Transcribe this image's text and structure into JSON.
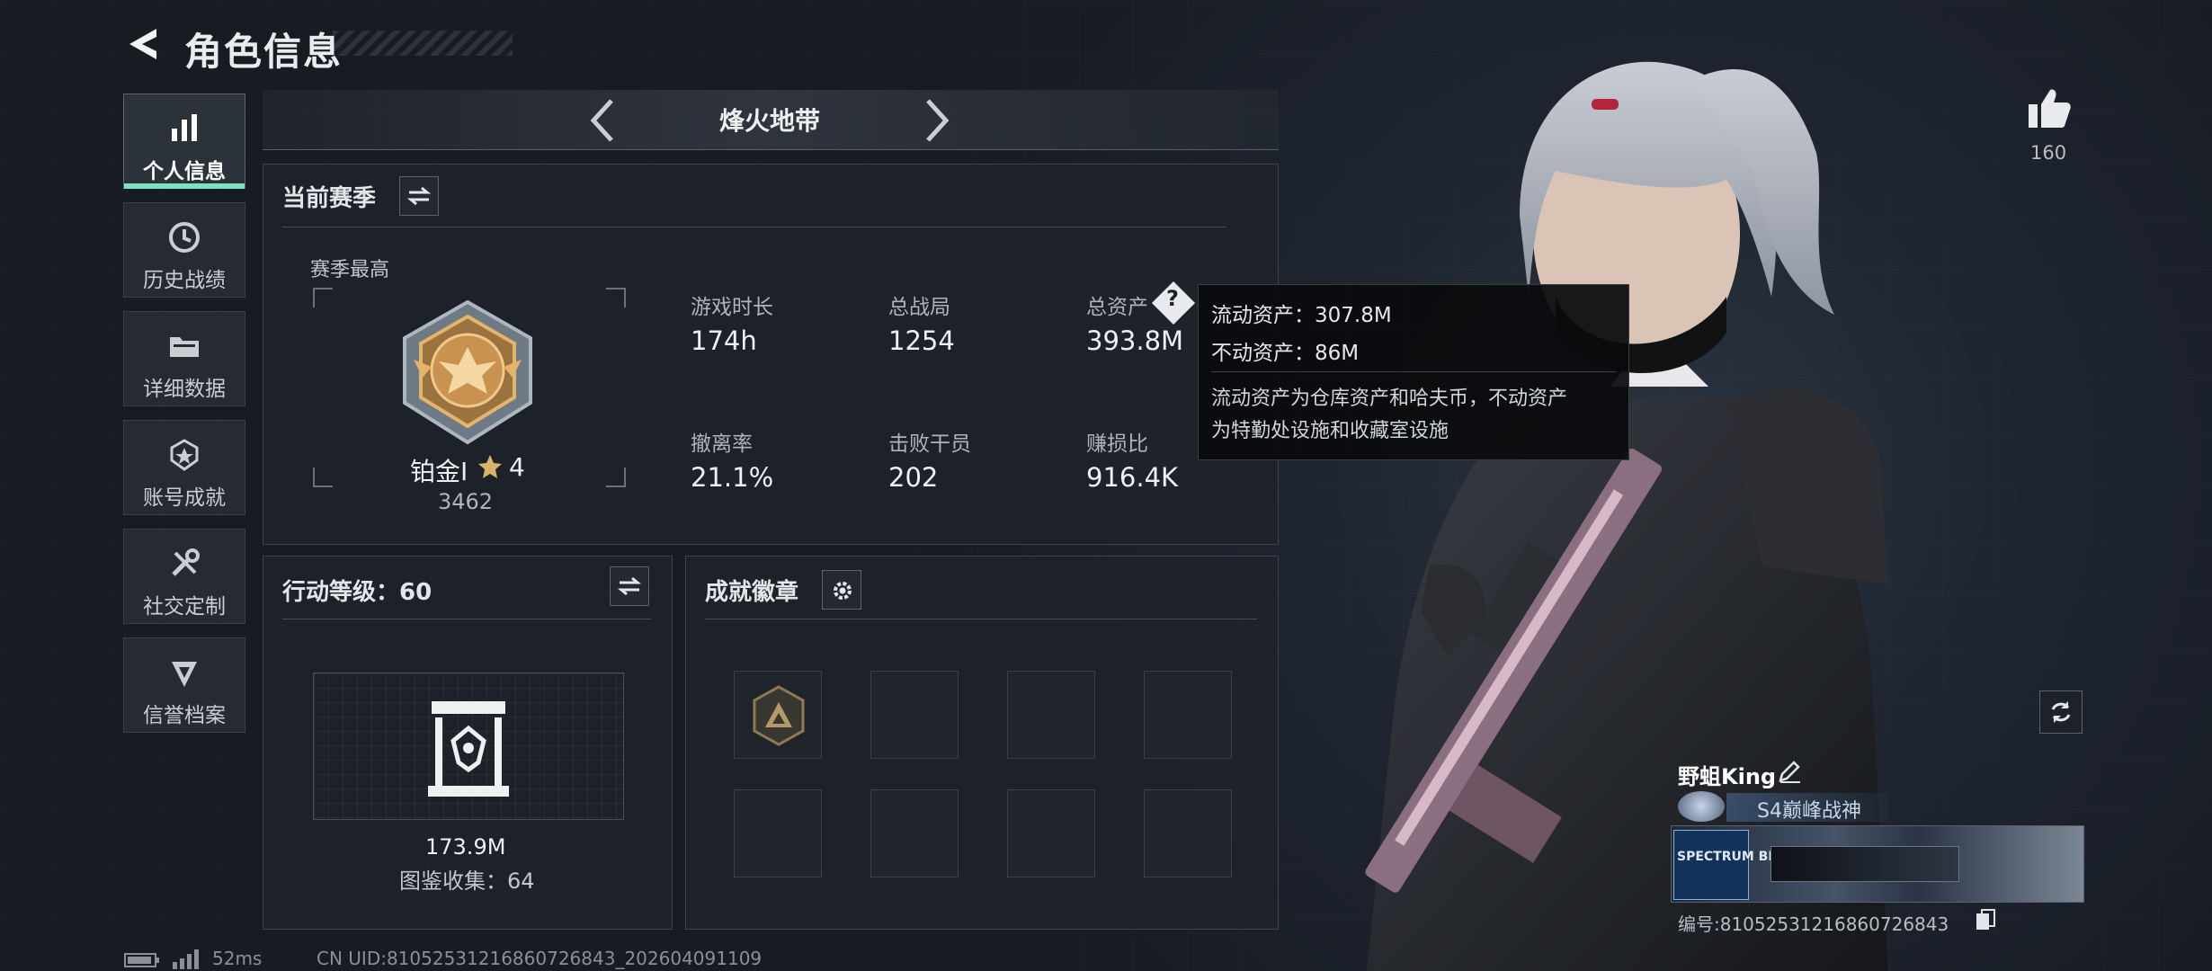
{
  "header": {
    "title": "角色信息"
  },
  "sidebar": {
    "items": [
      {
        "label": "个人信息",
        "icon": "bar-chart-icon",
        "active": true
      },
      {
        "label": "历史战绩",
        "icon": "clock-icon"
      },
      {
        "label": "详细数据",
        "icon": "folder-icon"
      },
      {
        "label": "账号成就",
        "icon": "badge-icon"
      },
      {
        "label": "社交定制",
        "icon": "tools-icon"
      },
      {
        "label": "信誉档案",
        "icon": "shield-icon"
      }
    ]
  },
  "mode": {
    "name": "烽火地带"
  },
  "season": {
    "title": "当前赛季",
    "best_label": "赛季最高",
    "rank_name": "铂金I",
    "rank_stars": "4",
    "rank_score": "3462",
    "stats": [
      {
        "label": "游戏时长",
        "value": "174h"
      },
      {
        "label": "总战局",
        "value": "1254"
      },
      {
        "label": "总资产",
        "value": "393.8M"
      },
      {
        "label": "撤离率",
        "value": "21.1%"
      },
      {
        "label": "击败干员",
        "value": "202"
      },
      {
        "label": "赚损比",
        "value": "916.4K"
      }
    ]
  },
  "tooltip": {
    "liquid": "流动资产：307.8M",
    "fixed": "不动资产：86M",
    "desc_line1": "流动资产为仓库资产和哈夫币，不动资产",
    "desc_line2": "为特勤处设施和收藏室设施"
  },
  "action_level": {
    "title": "行动等级：60",
    "value": "173.9M",
    "collection": "图鉴收集：64"
  },
  "achievements": {
    "title": "成就徽章"
  },
  "likes": {
    "count": "160"
  },
  "player": {
    "name": "野蛆King",
    "title": "S4巅峰战神",
    "id": "编号:8105253121686072684​3",
    "banner_text": "SPECTRUM BLITZ"
  },
  "footer": {
    "ping": "52ms",
    "uid": "CN UID:8105253121686072684​3_202604091109"
  },
  "colors": {
    "accent": "#7fe0c2",
    "background": "#1c2028",
    "panel": "#1e232b"
  }
}
